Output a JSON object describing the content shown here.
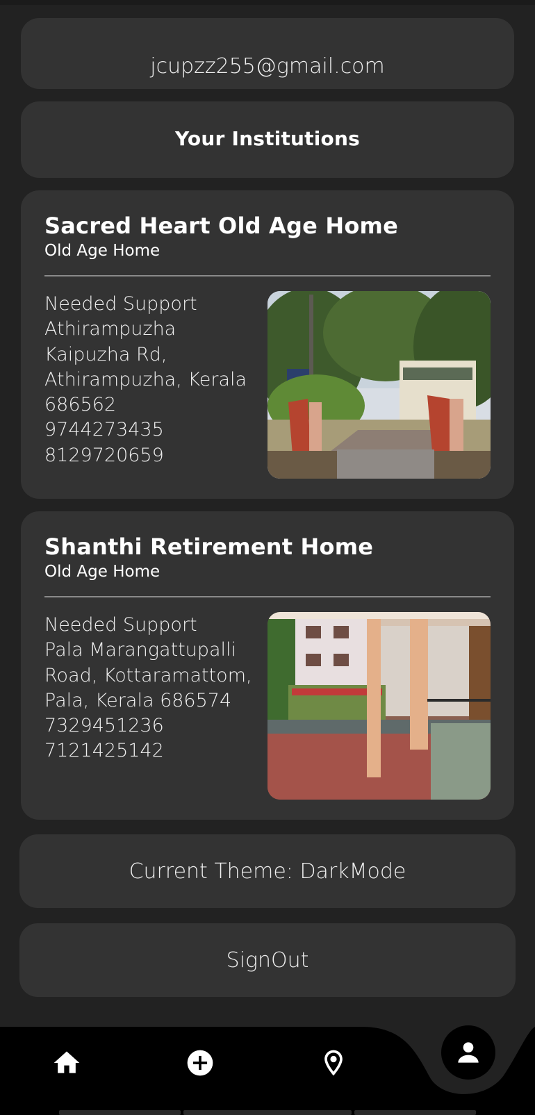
{
  "profile": {
    "email": "jcupzz255@gmail.com"
  },
  "section": {
    "title": "Your Institutions"
  },
  "institutions": [
    {
      "name": "Sacred Heart Old Age Home",
      "type": "Old Age Home",
      "lines": [
        "Needed Support",
        "Athirampuzha",
        "Kaipuzha Rd,",
        "Athirampuzha, Kerala",
        "686562",
        "9744273435",
        "8129720659"
      ]
    },
    {
      "name": "Shanthi Retirement Home",
      "type": "Old Age Home",
      "lines": [
        "Needed Support",
        "Pala Marangattupalli",
        "Road, Kottaramattom,",
        "Pala, Kerala 686574",
        "7329451236",
        "7121425142"
      ]
    }
  ],
  "settings": {
    "theme_label": "Current Theme: DarkMode",
    "signout_label": "SignOut"
  },
  "nav": {
    "items": [
      "home-icon",
      "add-circle-icon",
      "location-pin-icon",
      "person-icon"
    ],
    "active": "person-icon"
  },
  "colors": {
    "background": "#222222",
    "card": "#333333",
    "nav_bar": "#000000",
    "divider": "#8a8a8a"
  }
}
